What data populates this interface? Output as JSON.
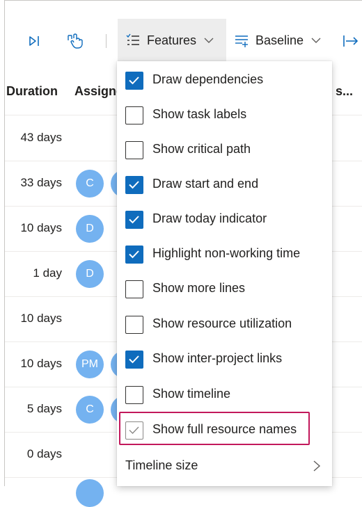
{
  "toolbar": {
    "features_label": "Features",
    "baseline_label": "Baseline"
  },
  "grid": {
    "headers": [
      "Duration",
      "Assigne",
      "y s..."
    ],
    "rows": [
      {
        "duration": "43 days",
        "avatars": []
      },
      {
        "duration": "33 days",
        "avatars": [
          "C"
        ]
      },
      {
        "duration": "10 days",
        "avatars": [
          "D"
        ]
      },
      {
        "duration": "1 day",
        "avatars": [
          "D"
        ]
      },
      {
        "duration": "10 days",
        "avatars": []
      },
      {
        "duration": "10 days",
        "avatars": [
          "PM"
        ]
      },
      {
        "duration": "5 days",
        "avatars": [
          "C"
        ]
      },
      {
        "duration": "0 days",
        "avatars": []
      }
    ]
  },
  "features_menu": {
    "items": [
      {
        "label": "Draw dependencies",
        "checked": true
      },
      {
        "label": "Show task labels",
        "checked": false
      },
      {
        "label": "Show critical path",
        "checked": false
      },
      {
        "label": "Draw start and end",
        "checked": true
      },
      {
        "label": "Draw today indicator",
        "checked": true
      },
      {
        "label": "Highlight non-working time",
        "checked": true
      },
      {
        "label": "Show more lines",
        "checked": false
      },
      {
        "label": "Show resource utilization",
        "checked": false
      },
      {
        "label": "Show inter-project links",
        "checked": true
      },
      {
        "label": "Show timeline",
        "checked": false
      },
      {
        "label": "Show full resource names",
        "checked": true,
        "disabled_look": true,
        "highlighted": true
      }
    ],
    "submenu_label": "Timeline size"
  },
  "colors": {
    "accent": "#0f6cbd",
    "avatar": "#74b2f0",
    "highlight_border": "#c2185b"
  }
}
